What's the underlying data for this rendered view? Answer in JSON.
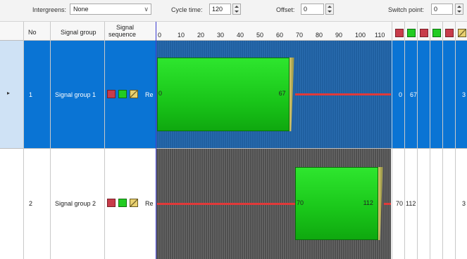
{
  "toolbar": {
    "intergreens_label": "Intergreens:",
    "intergreens_value": "None",
    "cycle_time_label": "Cycle time:",
    "cycle_time_value": "120",
    "offset_label": "Offset:",
    "offset_value": "0",
    "switch_point_label": "Switch point:",
    "switch_point_value": "0"
  },
  "columns": {
    "no": "No",
    "signal_group": "Signal group",
    "signal_sequence_line1": "Signal",
    "signal_sequence_line2": "sequence",
    "ticks": [
      "0",
      "10",
      "20",
      "30",
      "40",
      "50",
      "60",
      "70",
      "80",
      "90",
      "100",
      "110"
    ],
    "right_icons": [
      "red-icon",
      "green-icon",
      "red-icon",
      "green-icon",
      "red-amber-icon",
      "amber-icon"
    ]
  },
  "rows": [
    {
      "no": "1",
      "name": "Signal group 1",
      "seq_label": "Re",
      "green_start": 0,
      "green_end": 67,
      "start_label": "0",
      "end_label": "67",
      "col_a": "0",
      "col_b": "67",
      "col_last": "3"
    },
    {
      "no": "2",
      "name": "Signal group 2",
      "seq_label": "Re",
      "green_start": 70,
      "green_end": 112,
      "start_label": "70",
      "end_label": "112",
      "col_a": "70",
      "col_b": "112",
      "col_last": "3"
    }
  ],
  "colors": {
    "selected_row": "#0a74d4",
    "green": "#22cc22",
    "red": "#e03a3a",
    "amber": "#d8c96a"
  },
  "cycle_time": 120
}
